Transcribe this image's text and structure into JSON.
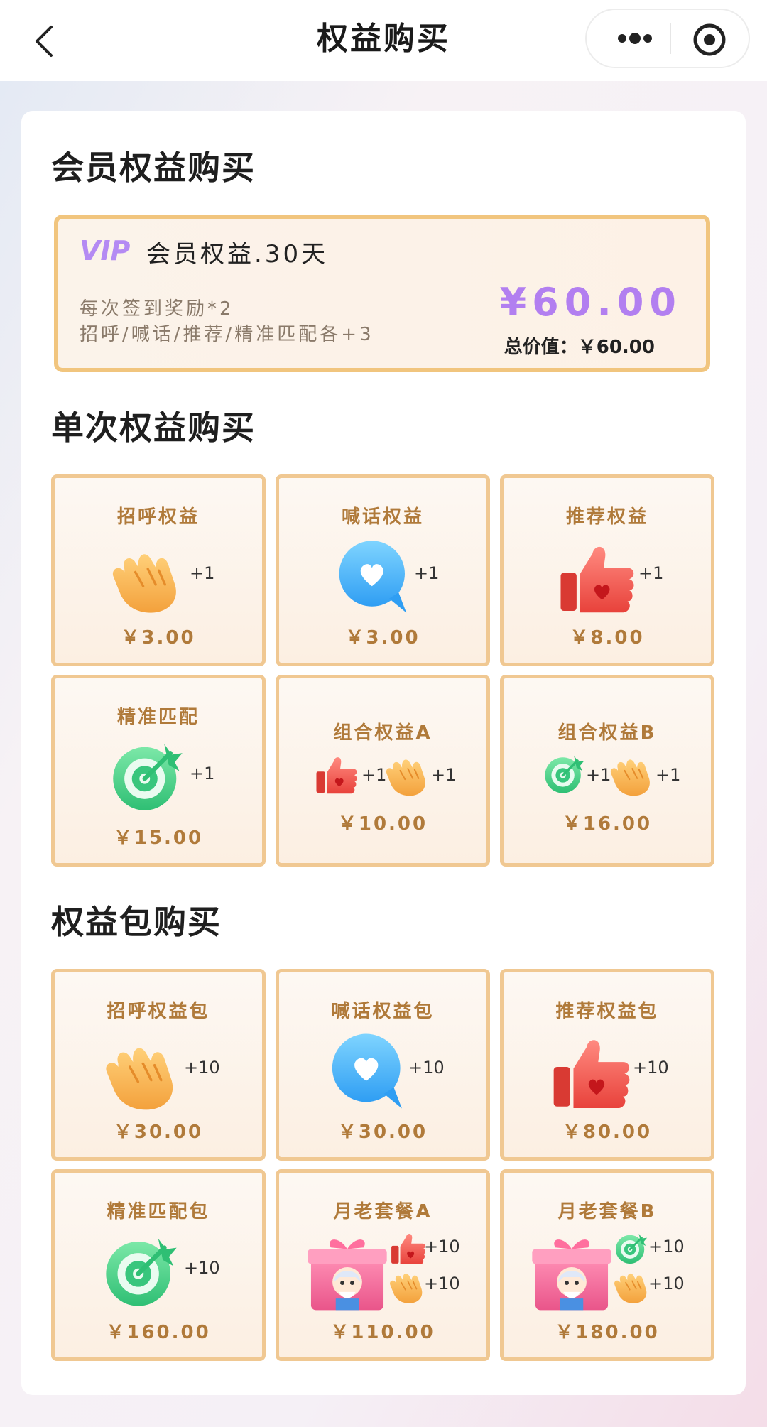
{
  "navbar": {
    "title": "权益购买"
  },
  "sections": {
    "member": "会员权益购买",
    "single": "单次权益购买",
    "pack": "权益包购买"
  },
  "vip": {
    "name": "会员权益.30天",
    "desc1": "每次签到奖励*2",
    "desc2": "招呼/喊话/推荐/精准匹配各+3",
    "price": "¥60.00",
    "total": "总价值：￥60.00"
  },
  "single": [
    {
      "title": "招呼权益",
      "price": "￥3.00",
      "plus": "+1"
    },
    {
      "title": "喊话权益",
      "price": "￥3.00",
      "plus": "+1"
    },
    {
      "title": "推荐权益",
      "price": "￥8.00",
      "plus": "+1"
    },
    {
      "title": "精准匹配",
      "price": "￥15.00",
      "plus": "+1"
    },
    {
      "title": "组合权益A",
      "price": "￥10.00",
      "plus1": "+1",
      "plus2": "+1"
    },
    {
      "title": "组合权益B",
      "price": "￥16.00",
      "plus1": "+1",
      "plus2": "+1"
    }
  ],
  "packs": [
    {
      "title": "招呼权益包",
      "price": "￥30.00",
      "plus": "+10"
    },
    {
      "title": "喊话权益包",
      "price": "￥30.00",
      "plus": "+10"
    },
    {
      "title": "推荐权益包",
      "price": "￥80.00",
      "plus": "+10"
    },
    {
      "title": "精准匹配包",
      "price": "￥160.00",
      "plus": "+10"
    },
    {
      "title": "月老套餐A",
      "price": "￥110.00",
      "plus1": "+10",
      "plus2": "+10"
    },
    {
      "title": "月老套餐B",
      "price": "￥180.00",
      "plus1": "+10",
      "plus2": "+10"
    }
  ],
  "colors": {
    "accent": "#b27ff0",
    "tile_border": "#f0c892",
    "tile_text": "#b07a3a",
    "vip_border": "#f1c57e"
  }
}
